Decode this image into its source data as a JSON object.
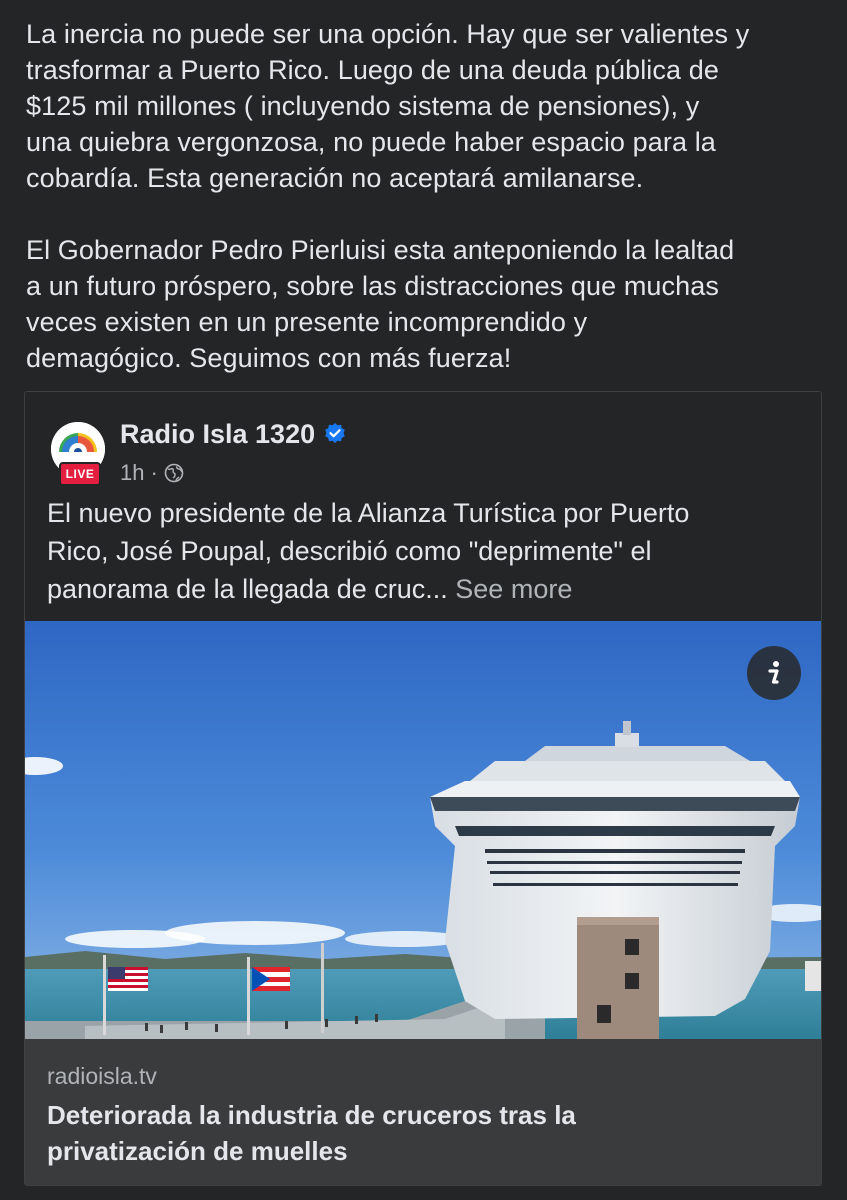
{
  "post": {
    "paragraphs": [
      "La inercia no puede ser una opción. Hay que ser valientes y\ntrasformar a Puerto Rico. Luego de una deuda pública de\n$125 mil millones ( incluyendo sistema de pensiones), y\nuna quiebra vergonzosa, no puede haber espacio para la\ncobardía. Esta generación no aceptará amilanarse.",
      "El Gobernador Pedro Pierluisi esta anteponiendo la lealtad\na un futuro próspero, sobre las distracciones que muchas\nveces existen en un presente incomprendido y\ndemagógico. Seguimos con más fuerza!"
    ]
  },
  "shared_post": {
    "page_name": "Radio Isla 1320",
    "live_badge": "LIVE",
    "timestamp": "1h",
    "separator": "·",
    "body_text": "El nuevo presidente de la Alianza Turística por Puerto\nRico, José Poupal, describió como \"depri­mente\" el\npanorama de la llegada de cruc...",
    "see_more_label": "See more",
    "link": {
      "domain": "radioisla.tv",
      "title": "Deteriorada la industria de cruceros tras la\nprivatización de muelles"
    }
  },
  "icons": {
    "verified": "verified-badge-icon",
    "audience": "globe-icon",
    "info": "info-icon"
  },
  "colors": {
    "background": "#242526",
    "text_primary": "#e4e6eb",
    "text_secondary": "#b0b3b8",
    "verified_blue": "#1877f2",
    "live_red": "#e41e3f",
    "link_footer_bg": "#3a3b3c"
  }
}
